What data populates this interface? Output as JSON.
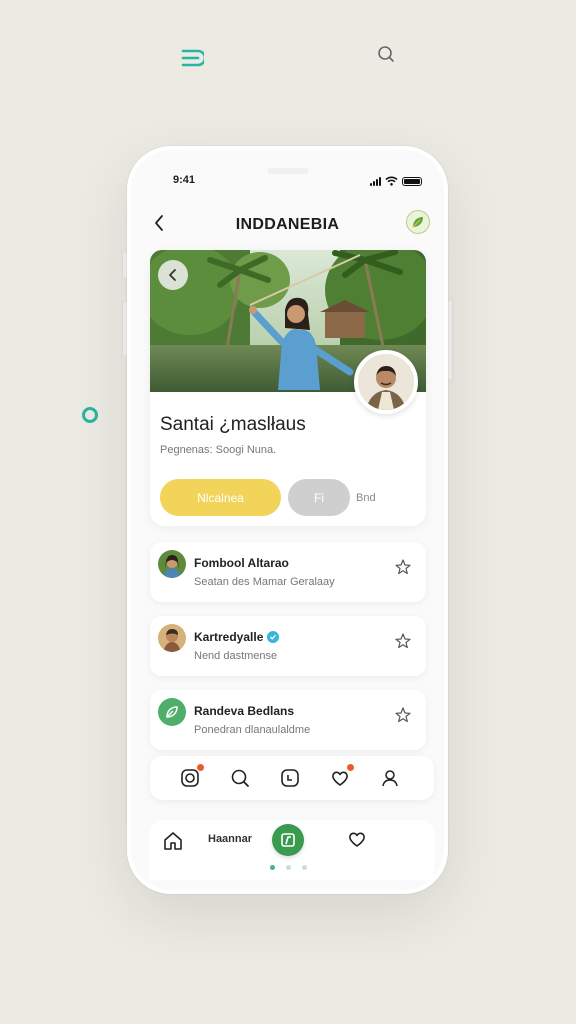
{
  "status_bar": {
    "time": "9:41"
  },
  "header": {
    "title": "INDDANEBIA"
  },
  "hero": {
    "name": "Santai ¿maslłaus",
    "subtitle": "Pegnenas: Soogi Nuna.",
    "primary_button": "Nlcalnea",
    "secondary_button": "Fi",
    "secondary_text": "Bnd"
  },
  "list": [
    {
      "title": "Fombool Altarao",
      "subtitle": "Seatan des Mamar Geralaay",
      "verified": false
    },
    {
      "title": "Kartredyalle",
      "subtitle": "Nend dastmense",
      "verified": true
    },
    {
      "title": "Randeva Bedlans",
      "subtitle": "Ponedran dlanaulaldme",
      "verified": false
    }
  ],
  "bottom_nav": {
    "label": "Haannar"
  },
  "colors": {
    "background": "#ecebe3",
    "accent_teal": "#2bb3a3",
    "primary_yellow": "#f2d45a",
    "secondary_gray": "#cfcfcf",
    "fab_green": "#3a9a4e",
    "notification_red": "#ee5a2c"
  },
  "icons": [
    "menu-icon",
    "search-icon",
    "back-icon",
    "leaf-badge-icon",
    "star-icon",
    "instagram-icon",
    "chat-icon",
    "heart-icon",
    "profile-icon",
    "home-icon"
  ]
}
